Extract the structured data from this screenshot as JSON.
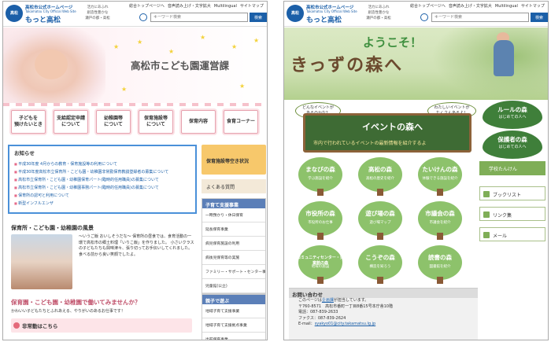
{
  "common": {
    "site_line1": "高松市公式ホームページ",
    "site_line2": "Takamatsu City Official Web Site",
    "site_line3": "もっと高松",
    "slogan": [
      "活力にあふれ",
      "創造性豊かな",
      "瀬戸の都・高松"
    ],
    "top_links": [
      "総合トップページへ",
      "音声読み上げ・文字拡大",
      "Multilingual",
      "サイトマップ"
    ],
    "search_placeholder": "キーワード検索",
    "search_button": "検索",
    "brand_color": "#1b5fa8"
  },
  "left": {
    "hero_title": "高松市こども園運営課",
    "tiles": [
      {
        "line1": "子どもを",
        "line2": "預けたいとき"
      },
      {
        "line1": "支給認定申請",
        "line2": "について"
      },
      {
        "line1": "幼稚園等",
        "line2": "について"
      },
      {
        "line1": "保育施設等",
        "line2": "について"
      },
      {
        "line1": "保育内容",
        "line2": ""
      },
      {
        "line1": "食育コーナー",
        "line2": ""
      }
    ],
    "news": {
      "heading": "お知らせ",
      "items": [
        "平成30年度 4月からの教育・保育施設等の利用について",
        "平成30年度高松市立保育所・こども園・幼稚園非常勤保育教諭登録者の募集について",
        "高松市立保育所・こども園・幼稚園保育パート(臨時的任用職員)の募集について",
        "高松市立保育所・こども園・幼稚園事務パート(臨時的任用職員)の募集について",
        "保育所の認可と利用について",
        "新型インフルエンザ"
      ]
    },
    "section1_title": "保育所・こども園・幼稚園の風景",
    "section1_text": "〜いうご飯 おいしそうだな〜 保育所の昼食では、食育活動の一環で高松市の郷土料理「いりこ飯」を作りました。 小さいクラスの子どもたちも興味津々、張り切ってお手伝いしてくれました。食べる前から良い笑顔でしたよ。",
    "section2_title": "保育園・こども園・幼稚園で働いてみませんか？",
    "section2_sub": "かわいい子どもたちとふれあえる、やりがいのあるお仕事です！",
    "recruit_label": "非常勤はこちら",
    "side": {
      "nursery_button": "保育施設等空き状況",
      "faq": "よくある質問",
      "box1_title": "子育て支援事業",
      "box1_items": [
        "一時預かり・休日保育",
        "延長保育事業",
        "病児保育施設の利用",
        "病後児保育等の実施",
        "ファミリー・サポート・センター事業",
        "児童館(公立)"
      ],
      "box2_title": "親子で遊ぶ",
      "box2_items": [
        "地域子育て支援事業",
        "地域子育て支援拠点事業",
        "出前保育事業"
      ]
    }
  },
  "right": {
    "hero_line1": "ようこそ！",
    "hero_line2": "きっずの森へ",
    "bubble1": [
      "どんなイベントが",
      "あるのかな？"
    ],
    "bubble2": [
      "わたしいイベントが",
      "たくさんあるよ！"
    ],
    "board_title": "イベントの森へ",
    "board_sub": "市内で行われているイベントの最新情報を紹介するよ",
    "leaf1": [
      "ルールの森",
      "はじめての人へ"
    ],
    "leaf2": [
      "保護者の森",
      "はじめての人へ"
    ],
    "trees": [
      {
        "name": "まなびの森",
        "sub": "学ぶ施設を紹介"
      },
      {
        "name": "高松の森",
        "sub": "高松の歴史を紹介"
      },
      {
        "name": "たいけんの森",
        "sub": "体験できる施設を紹介"
      },
      {
        "name": "市役所の森",
        "sub": "市役所のお仕事"
      },
      {
        "name": "遊び場の森",
        "sub": "遊び場マップ"
      },
      {
        "name": "市議会の森",
        "sub": "市議会を紹介"
      },
      {
        "name": "コミュニティセンター・児童館の森",
        "sub": "地域の施設"
      },
      {
        "name": "こうぞの森",
        "sub": "構造を知ろう"
      },
      {
        "name": "読書の森",
        "sub": "図書館を紹介"
      }
    ],
    "side": {
      "school_button": "学校たんけん",
      "links": [
        "ブックリスト",
        "リンク集",
        "メール"
      ]
    },
    "contact": {
      "heading": "お問い合わせ",
      "lines": [
        "このページは",
        "〒760-8571　高松市番町一丁目8番15号本庁舎10階",
        "電話：087-839-2633",
        "ファクス：087-839-2624",
        "E-mail："
      ],
      "dept": "企画課",
      "email": "syakyo01@city.takamatsu.lg.jp",
      "suffix": "が担当しています。"
    }
  }
}
